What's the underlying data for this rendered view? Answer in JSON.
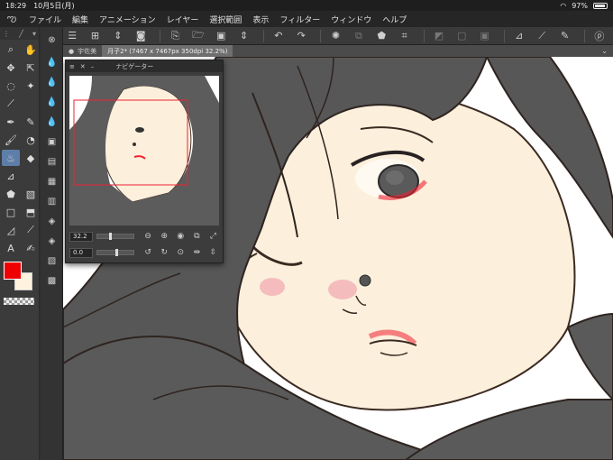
{
  "status": {
    "time": "18:29",
    "date": "10月5日(月)",
    "battery": "97%"
  },
  "menu": {
    "items": [
      "ファイル",
      "編集",
      "アニメーション",
      "レイヤー",
      "選択範囲",
      "表示",
      "フィルター",
      "ウィンドウ",
      "ヘルプ"
    ]
  },
  "tab": {
    "name1": "宇佐美",
    "name2": "月子2* (7467 x 7467px 350dpi 32.2%)"
  },
  "navigator": {
    "title": "ナビゲーター",
    "zoom": "32.2",
    "rotation": "0.0",
    "zoom_fraction": 0.32,
    "rotation_fraction": 0.5
  },
  "colors": {
    "main": "#ee0000",
    "sub": "#fff3e0"
  },
  "icons": {
    "toolbar": [
      "menu-icon",
      "new-icon",
      "layers-updown-icon",
      "camera-icon",
      "new-file-icon",
      "open-folder-icon",
      "save-icon",
      "updown-icon",
      "undo-icon",
      "redo-icon",
      "loading-icon",
      "transform-icon",
      "fill-icon",
      "crop-icon",
      "canvas-icon",
      "invert-icon",
      "clear-icon",
      "ruler-icon",
      "brush-icon",
      "pen-icon",
      "help-icon"
    ],
    "tools": [
      "brush-size-icon",
      "pen-icon",
      "zoom-icon",
      "hand-icon",
      "move-icon",
      "select-icon",
      "lasso-icon",
      "auto-select-icon",
      "eyedropper-icon",
      "pen-tool-icon",
      "pencil-icon",
      "brush-tool-icon",
      "airbrush-icon",
      "blend-icon",
      "eraser-icon",
      "fill-tool-icon",
      "gradient-icon",
      "rect-icon",
      "shape-icon",
      "line-icon",
      "text-icon",
      "balloon-icon"
    ]
  }
}
